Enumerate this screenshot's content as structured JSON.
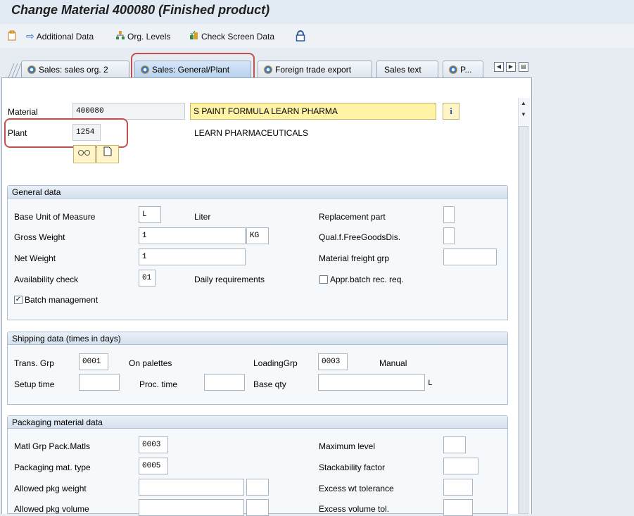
{
  "title": "Change Material 400080 (Finished product)",
  "toolbar": {
    "additional_data": "Additional Data",
    "org_levels": "Org. Levels",
    "check_screen_data": "Check Screen Data"
  },
  "tabs": [
    {
      "label": "Sales: sales org. 2"
    },
    {
      "label": "Sales: General/Plant"
    },
    {
      "label": "Foreign trade export"
    },
    {
      "label": "Sales text"
    },
    {
      "label": "P..."
    }
  ],
  "header": {
    "material_label": "Material",
    "material_value": "400080",
    "material_desc": "S PAINT FORMULA LEARN PHARMA",
    "plant_label": "Plant",
    "plant_value": "1254",
    "plant_desc": "LEARN PHARMACEUTICALS"
  },
  "general": {
    "title": "General data",
    "base_uom_label": "Base Unit of Measure",
    "base_uom_value": "L",
    "base_uom_text": "Liter",
    "gross_weight_label": "Gross Weight",
    "gross_weight_value": "1",
    "weight_unit": "KG",
    "net_weight_label": "Net Weight",
    "net_weight_value": "1",
    "availability_label": "Availability check",
    "availability_value": "01",
    "availability_text": "Daily requirements",
    "batch_label": "Batch management",
    "replacement_label": "Replacement part",
    "qual_label": "Qual.f.FreeGoodsDis.",
    "freight_label": "Material freight grp",
    "appr_label": "Appr.batch rec. req."
  },
  "shipping": {
    "title": "Shipping data (times in days)",
    "trans_grp_label": "Trans. Grp",
    "trans_grp_value": "0001",
    "trans_grp_text": "On palettes",
    "loading_grp_label": "LoadingGrp",
    "loading_grp_value": "0003",
    "loading_grp_text": "Manual",
    "setup_time_label": "Setup time",
    "proc_time_label": "Proc. time",
    "base_qty_label": "Base qty",
    "base_qty_unit": "L"
  },
  "packaging": {
    "title": "Packaging material data",
    "matl_grp_label": "Matl Grp Pack.Matls",
    "matl_grp_value": "0003",
    "pkg_type_label": "Packaging mat. type",
    "pkg_type_value": "0005",
    "allowed_weight_label": "Allowed pkg weight",
    "allowed_volume_label": "Allowed pkg volume",
    "max_level_label": "Maximum level",
    "stack_label": "Stackability factor",
    "excess_wt_label": "Excess wt tolerance",
    "excess_vol_label": "Excess volume tol."
  },
  "colors": {
    "highlight": "#c0504d",
    "description_bg": "#fff3a6"
  }
}
